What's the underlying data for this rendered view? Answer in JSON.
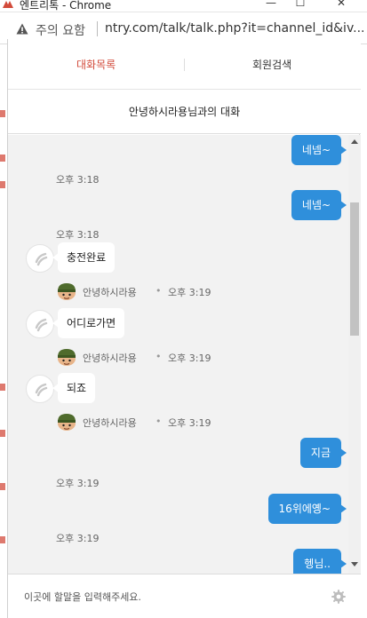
{
  "window": {
    "title": "엔트리톡 - Chrome",
    "minimize_glyph": "—",
    "maximize_glyph": "☐",
    "close_glyph": "✕"
  },
  "address": {
    "security_label": "주의 요함",
    "url": "ntry.com/talk/talk.php?it=channel_id&iv..."
  },
  "tabs": [
    {
      "label": "대화목록",
      "active": true
    },
    {
      "label": "회원검색",
      "active": false
    }
  ],
  "conversation": {
    "title": "안녕하시라용님과의 대화"
  },
  "messages": [
    {
      "sender": "me",
      "text": "네넴~",
      "time": "오후 3:18"
    },
    {
      "sender": "me",
      "text": "네넴~",
      "time": "오후 3:18"
    },
    {
      "sender": "other",
      "text": "충전완료",
      "name": "안녕하시라용",
      "time": "오후 3:19"
    },
    {
      "sender": "other",
      "text": "어디로가면",
      "name": "안녕하시라용",
      "time": "오후 3:19"
    },
    {
      "sender": "other",
      "text": "되죠",
      "name": "안녕하시라용",
      "time": "오후 3:19"
    },
    {
      "sender": "me",
      "text": "지금",
      "time": "오후 3:19"
    },
    {
      "sender": "me",
      "text": "16위에옝~",
      "time": "오후 3:19"
    },
    {
      "sender": "me",
      "text": "헹님..",
      "time": ""
    }
  ],
  "separator_dot": "•",
  "input": {
    "placeholder": "이곳에 할말을 입력해주세요.",
    "value": ""
  },
  "colors": {
    "accent_red": "#d24a3a",
    "my_bubble": "#2f8fdb",
    "chat_background": "#f2f2f2"
  },
  "icons": {
    "warning": "warning-triangle-icon",
    "settings": "gear-icon",
    "avatar_default": "default-avatar-icon",
    "user_character": "soldier-avatar-icon"
  }
}
